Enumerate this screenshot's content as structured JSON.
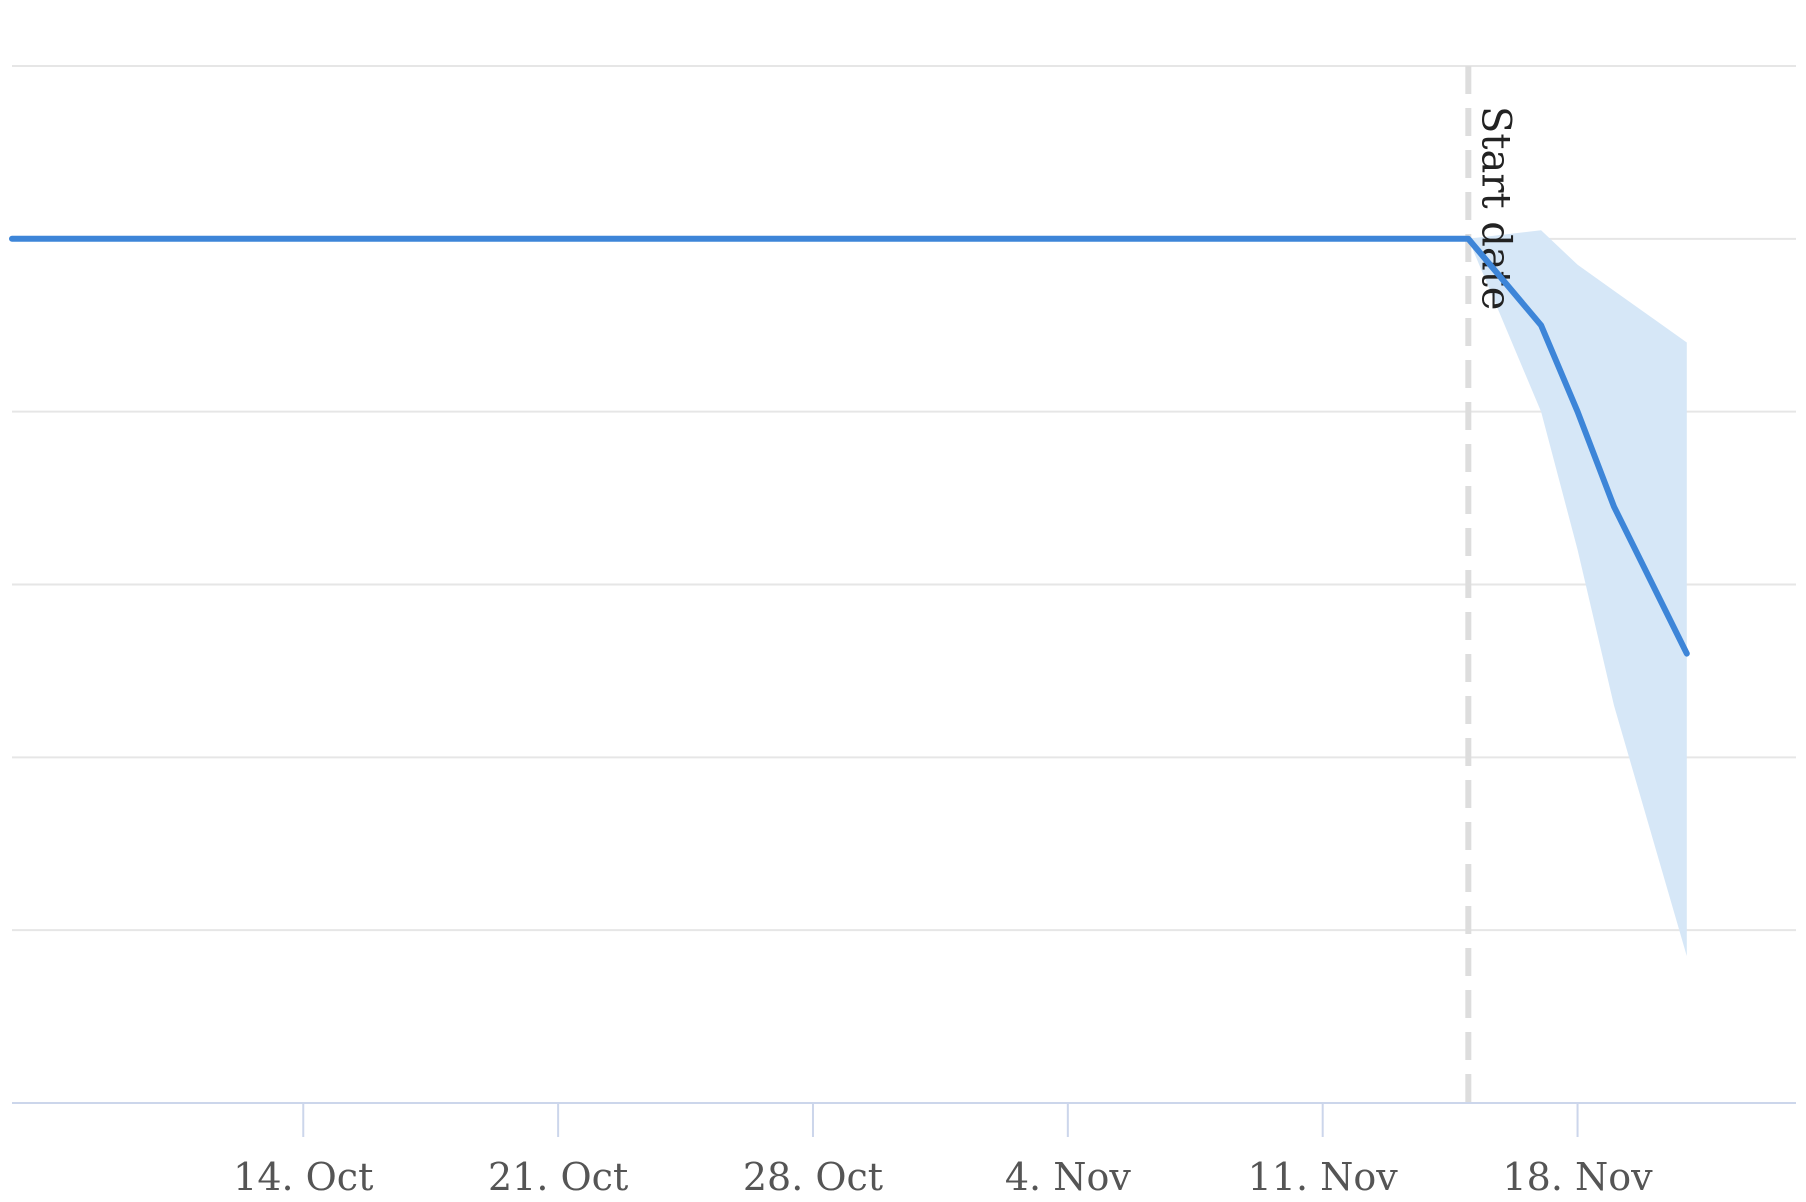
{
  "chart_data": {
    "type": "line",
    "title": "",
    "xlabel": "",
    "ylabel": "",
    "x_axis": {
      "type": "datetime",
      "range": [
        "2019-10-06",
        "2019-11-24"
      ],
      "ticks": [
        {
          "date": "2019-10-14",
          "label": "14. Oct"
        },
        {
          "date": "2019-10-21",
          "label": "21. Oct"
        },
        {
          "date": "2019-10-28",
          "label": "28. Oct"
        },
        {
          "date": "2019-11-04",
          "label": "4. Nov"
        },
        {
          "date": "2019-11-11",
          "label": "11. Nov"
        },
        {
          "date": "2019-11-18",
          "label": "18. Nov"
        }
      ]
    },
    "y_axis": {
      "range": [
        0,
        6
      ],
      "gridlines": [
        0,
        1,
        2,
        3,
        4,
        5,
        6
      ],
      "tick_labels_shown": false
    },
    "grid": true,
    "legend": false,
    "plot_lines": [
      {
        "date": "2019-11-15",
        "label": "Start date",
        "style": "dashed",
        "color": "#dddddd"
      }
    ],
    "series": [
      {
        "type": "line",
        "color": "#3d85d8",
        "points": [
          {
            "x": "2019-10-06",
            "y": 5.0
          },
          {
            "x": "2019-11-15",
            "y": 5.0
          },
          {
            "x": "2019-11-17",
            "y": 4.5
          },
          {
            "x": "2019-11-18",
            "y": 4.0
          },
          {
            "x": "2019-11-19",
            "y": 3.45
          },
          {
            "x": "2019-11-21",
            "y": 2.6
          }
        ]
      },
      {
        "type": "arearange",
        "color": "#d6e7f7",
        "points": [
          {
            "x": "2019-11-15",
            "low": 5.0,
            "high": 5.0
          },
          {
            "x": "2019-11-17",
            "low": 4.0,
            "high": 5.05
          },
          {
            "x": "2019-11-18",
            "low": 3.2,
            "high": 4.85
          },
          {
            "x": "2019-11-19",
            "low": 2.3,
            "high": 4.7
          },
          {
            "x": "2019-11-21",
            "low": 0.85,
            "high": 4.4
          }
        ]
      }
    ]
  }
}
